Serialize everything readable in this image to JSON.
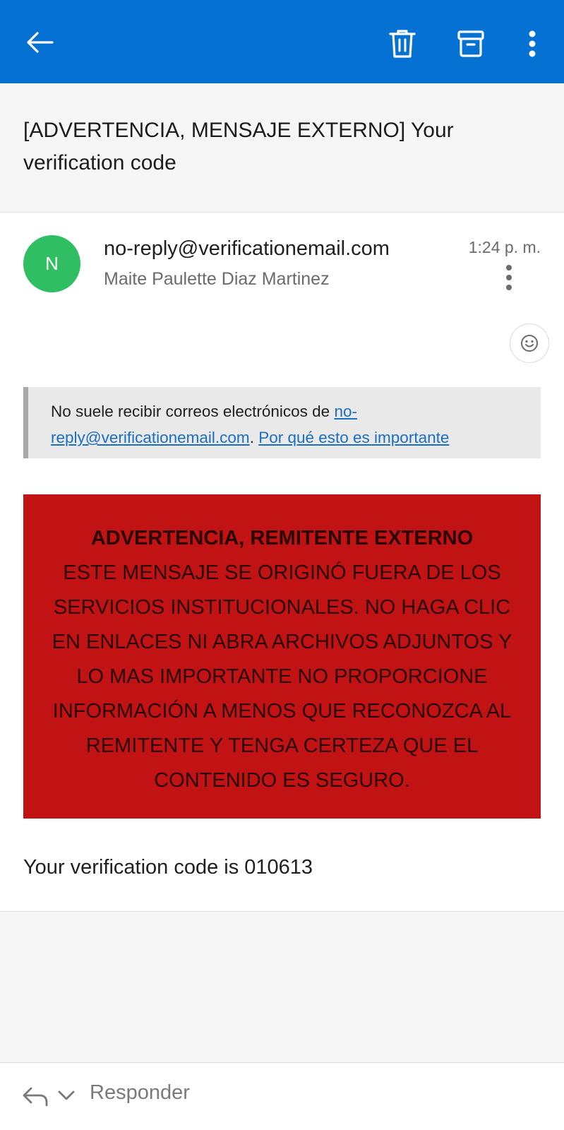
{
  "toolbar": {
    "back_icon": "arrow-left-icon",
    "delete_icon": "trash-icon",
    "archive_icon": "archive-icon",
    "more_icon": "more-vertical-icon",
    "color": "#0571d3"
  },
  "subject": "[ADVERTENCIA, MENSAJE EXTERNO] Your verification code",
  "message": {
    "avatar_initial": "N",
    "avatar_color": "#2fbe62",
    "sender": "no-reply@verificationemail.com",
    "recipient": "Maite Paulette Diaz Martinez",
    "time": "1:24 p. m.",
    "reaction_icon": "smiley-icon"
  },
  "notice": {
    "prefix": "No suele recibir correos electrónicos de ",
    "sender_link": "no-reply@verificationemail.com",
    "separator": ". ",
    "why_link": "Por qué esto es importante"
  },
  "warning": {
    "title": "ADVERTENCIA, REMITENTE EXTERNO",
    "body": "ESTE MENSAJE SE ORIGINÓ FUERA DE LOS SERVICIOS INSTITUCIONALES. NO HAGA CLIC EN ENLACES NI ABRA ARCHIVOS ADJUNTOS Y LO MAS IMPORTANTE NO PROPORCIONE INFORMACIÓN A MENOS QUE RECONOZCA AL REMITENTE Y TENGA CERTEZA QUE EL CONTENIDO ES SEGURO.",
    "background": "#c11313"
  },
  "body_text": "Your verification code is 010613",
  "reply_bar": {
    "reply_icon": "reply-icon",
    "chevron_icon": "chevron-down-icon",
    "label": "Responder"
  }
}
